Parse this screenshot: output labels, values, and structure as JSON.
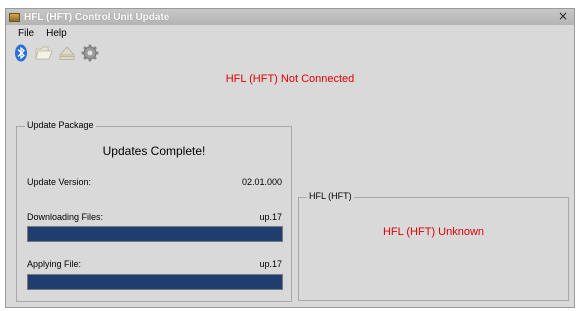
{
  "window": {
    "title": "HFL (HFT) Control Unit Update",
    "close_glyph": "×"
  },
  "menu": [
    {
      "label": "File"
    },
    {
      "label": "Help"
    }
  ],
  "toolbar": {
    "icons": [
      "bluetooth-icon",
      "folder-icon",
      "eject-icon",
      "settings-gear-icon"
    ]
  },
  "connection_status": {
    "text": "HFL (HFT) Not Connected",
    "color": "#e00000"
  },
  "update_package": {
    "group_title": "Update Package",
    "status_text": "Updates Complete!",
    "version_label": "Update Version:",
    "version_value": "02.01.000",
    "downloading_label": "Downloading Files:",
    "downloading_value": "up.17",
    "downloading_progress": 1.0,
    "applying_label": "Applying File:",
    "applying_value": "up.17",
    "applying_progress": 1.0,
    "progress_color": "#1f3d6e"
  },
  "hfl_panel": {
    "group_title": "HFL (HFT)",
    "status_text": "HFL (HFT) Unknown",
    "status_color": "#e00000"
  }
}
